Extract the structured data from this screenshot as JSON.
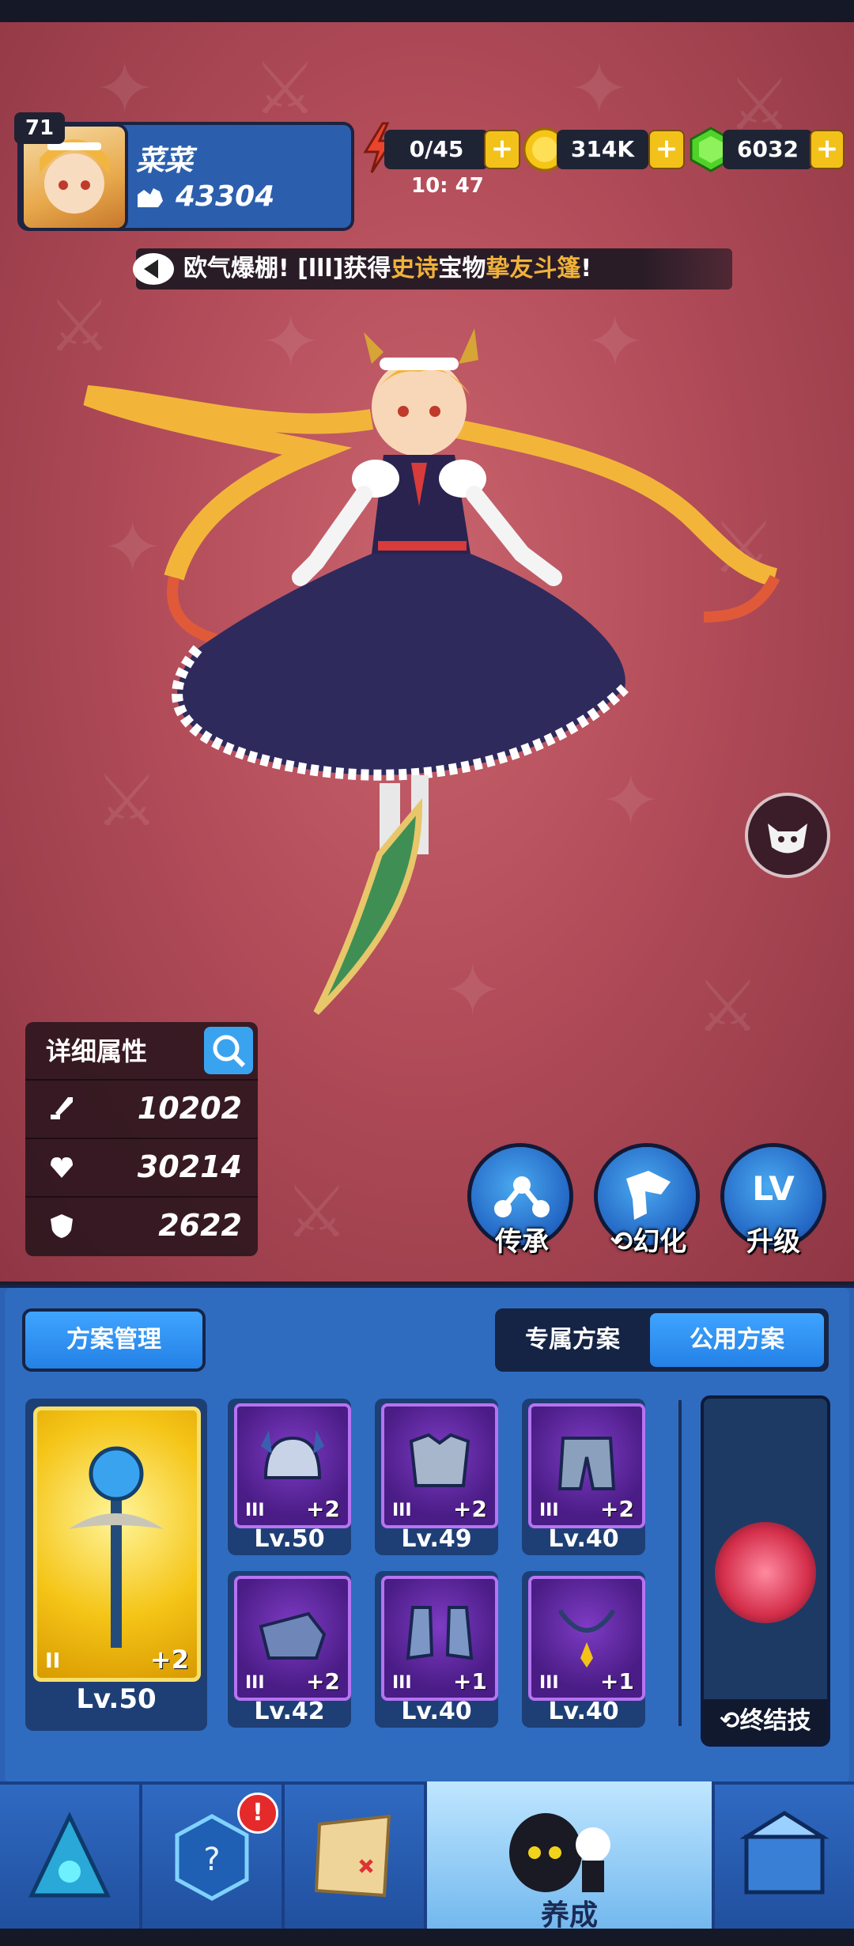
{
  "player": {
    "level": "71",
    "name": "菜菜",
    "power": "43304"
  },
  "resources": {
    "stamina": "0/45",
    "stamina_timer": "10: 47",
    "gold": "314K",
    "gems": "6032"
  },
  "announcement": {
    "prefix": "欧气爆棚! [lll]获得",
    "rarity": "史诗",
    "middle": "宝物",
    "item": "挚友斗篷",
    "suffix": "!"
  },
  "stats": {
    "title": "详细属性",
    "attack": "10202",
    "hp": "30214",
    "defense": "2622"
  },
  "actions": {
    "inherit": "传承",
    "transform": "幻化",
    "upgrade": "升级",
    "upgrade_icon_text": "LV"
  },
  "panel": {
    "plan_manage": "方案管理",
    "tab_exclusive": "专属方案",
    "tab_public": "公用方案",
    "weapon": {
      "tier": "II",
      "plus": "+2",
      "level": "Lv.50"
    },
    "gear": [
      {
        "name": "helmet",
        "tier": "III",
        "plus": "+2",
        "level": "Lv.50"
      },
      {
        "name": "armor",
        "tier": "III",
        "plus": "+2",
        "level": "Lv.49"
      },
      {
        "name": "pants",
        "tier": "III",
        "plus": "+2",
        "level": "Lv.40"
      },
      {
        "name": "gauntlet",
        "tier": "III",
        "plus": "+2",
        "level": "Lv.42"
      },
      {
        "name": "boots",
        "tier": "III",
        "plus": "+1",
        "level": "Lv.40"
      },
      {
        "name": "necklace",
        "tier": "III",
        "plus": "+1",
        "level": "Lv.40"
      }
    ],
    "ultimate": "终结技"
  },
  "nav": {
    "active_label": "养成",
    "badge": "!"
  },
  "colors": {
    "background": "#b24c59",
    "panel": "#2f6cc0",
    "gold": "#f2c21b",
    "rarity": "#f0b23a",
    "epic_purple": "#b673f2"
  }
}
